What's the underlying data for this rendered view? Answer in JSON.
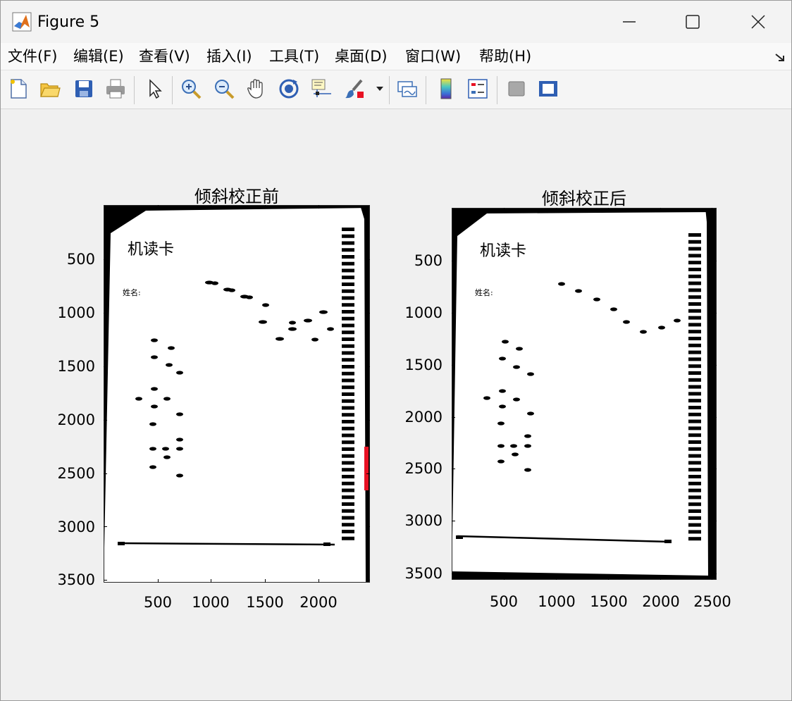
{
  "window": {
    "title": "Figure 5"
  },
  "menu": [
    {
      "label": "文件(F)"
    },
    {
      "label": "编辑(E)"
    },
    {
      "label": "查看(V)"
    },
    {
      "label": "插入(I)"
    },
    {
      "label": "工具(T)"
    },
    {
      "label": "桌面(D)"
    },
    {
      "label": "窗口(W)"
    },
    {
      "label": "帮助(H)"
    }
  ],
  "toolbar": [
    {
      "icon": "new-figure-icon"
    },
    {
      "icon": "open-file-icon"
    },
    {
      "icon": "save-icon"
    },
    {
      "icon": "print-icon"
    },
    {
      "icon": "select-arrow-icon"
    },
    {
      "icon": "zoom-in-icon"
    },
    {
      "icon": "zoom-out-icon"
    },
    {
      "icon": "pan-hand-icon"
    },
    {
      "icon": "rotate-3d-icon"
    },
    {
      "icon": "data-cursor-icon"
    },
    {
      "icon": "brush-icon"
    },
    {
      "icon": "link-plot-icon"
    },
    {
      "icon": "colorbar-icon"
    },
    {
      "icon": "legend-icon"
    },
    {
      "icon": "hide-plot-tools-icon"
    },
    {
      "icon": "show-plot-tools-icon"
    }
  ],
  "axes": [
    {
      "title": "倾斜校正前",
      "card_label": "机读卡",
      "name_label": "姓名:",
      "yticks": [
        "500",
        "1000",
        "1500",
        "2000",
        "2500",
        "3000",
        "3500"
      ],
      "xticks": [
        "500",
        "1000",
        "1500",
        "2000"
      ]
    },
    {
      "title": "倾斜校正后",
      "card_label": "机读卡",
      "name_label": "姓名:",
      "yticks": [
        "500",
        "1000",
        "1500",
        "2000",
        "2500",
        "3000",
        "3500"
      ],
      "xticks": [
        "500",
        "1000",
        "1500",
        "2000",
        "2500"
      ]
    }
  ],
  "colors": {
    "marker_red": "#e81123",
    "accent_blue": "#1e73c8"
  }
}
